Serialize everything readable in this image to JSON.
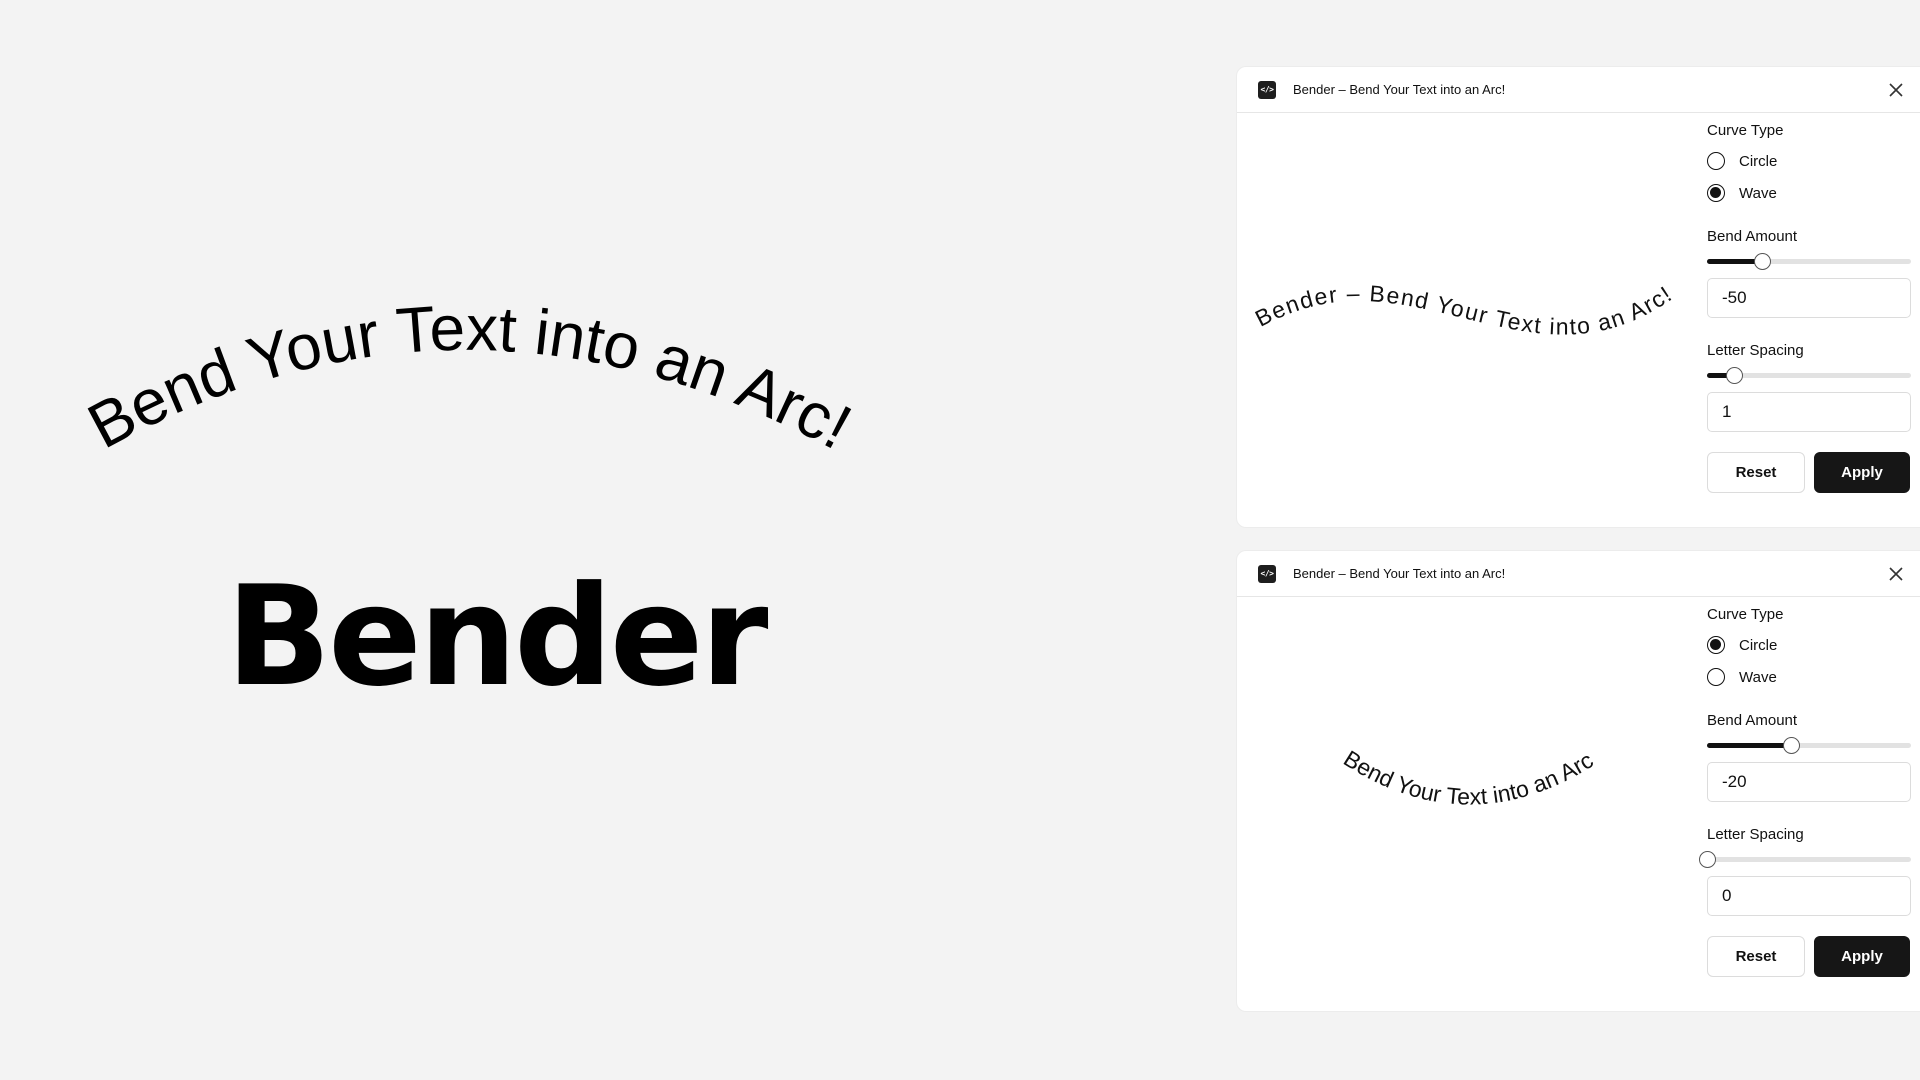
{
  "hero": {
    "arc_text": "Bend Your Text into an Arc!",
    "title": "Bender"
  },
  "panels": [
    {
      "icon": "code-icon",
      "icon_glyph": "</>",
      "title": "Bender – Bend Your Text into an Arc!",
      "preview_text": "Bender – Bend Your Text into an Arc!",
      "curve_type_label": "Curve Type",
      "curve_options": [
        {
          "label": "Circle",
          "checked": false
        },
        {
          "label": "Wave",
          "checked": true
        }
      ],
      "bend_amount_label": "Bend Amount",
      "bend_amount_value": "-50",
      "bend_amount_fraction": 0.27,
      "letter_spacing_label": "Letter Spacing",
      "letter_spacing_value": "1",
      "letter_spacing_fraction": 0.13,
      "reset_label": "Reset",
      "apply_label": "Apply"
    },
    {
      "icon": "code-icon",
      "icon_glyph": "</>",
      "title": "Bender – Bend Your Text into an Arc!",
      "preview_text": "Bend Your Text into an Arc",
      "curve_type_label": "Curve Type",
      "curve_options": [
        {
          "label": "Circle",
          "checked": true
        },
        {
          "label": "Wave",
          "checked": false
        }
      ],
      "bend_amount_label": "Bend Amount",
      "bend_amount_value": "-20",
      "bend_amount_fraction": 0.41,
      "letter_spacing_label": "Letter Spacing",
      "letter_spacing_value": "0",
      "letter_spacing_fraction": 0.0,
      "reset_label": "Reset",
      "apply_label": "Apply"
    }
  ],
  "colors": {
    "background": "#f3f3f3",
    "panel": "#ffffff",
    "accent": "#161616"
  }
}
